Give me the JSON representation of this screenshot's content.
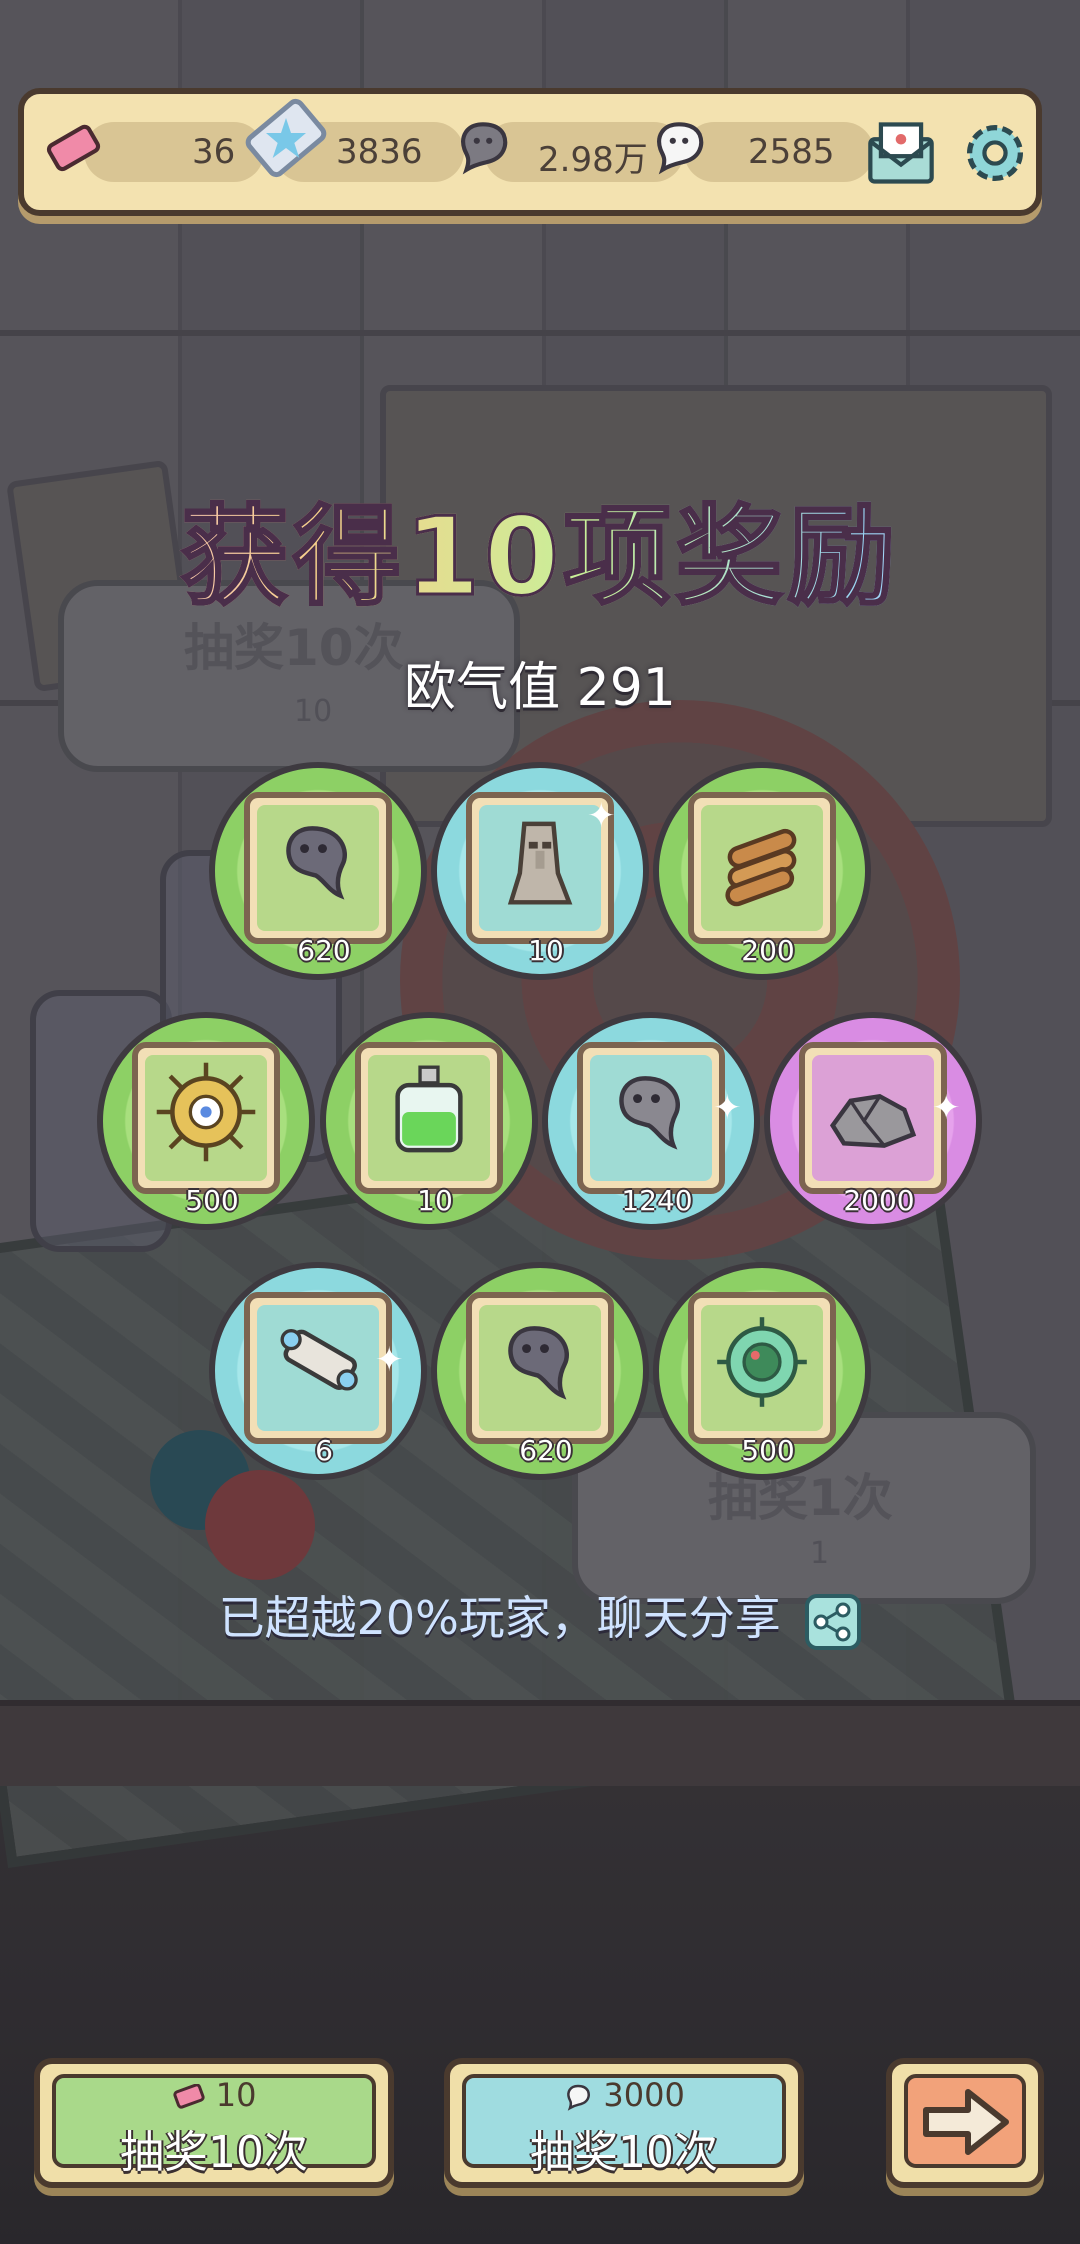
{
  "resources": [
    {
      "icon": "ticket-pink-icon",
      "value": "36"
    },
    {
      "icon": "ticket-blue-icon",
      "value": "3836"
    },
    {
      "icon": "ghost-gray-icon",
      "value": "2.98万"
    },
    {
      "icon": "ghost-white-icon",
      "value": "2585"
    }
  ],
  "header_buttons": {
    "mail": "mail-icon",
    "settings": "gear-icon"
  },
  "background_bubbles": {
    "left": {
      "title": "抽奖10次",
      "cost": "10"
    },
    "right": {
      "title": "抽奖1次",
      "cost": "1"
    }
  },
  "title": "获得10项奖励",
  "luck_text": "欧气值 291",
  "rewards": [
    {
      "icon": "ghost-essence-icon",
      "qty": "620",
      "rarity": "green"
    },
    {
      "icon": "stone-statue-icon",
      "qty": "10",
      "rarity": "blue"
    },
    {
      "icon": "wood-logs-icon",
      "qty": "200",
      "rarity": "green"
    },
    {
      "icon": "golden-wheel-icon",
      "qty": "500",
      "rarity": "green"
    },
    {
      "icon": "green-potion-icon",
      "qty": "10",
      "rarity": "green"
    },
    {
      "icon": "ghost-essence-icon",
      "qty": "1240",
      "rarity": "blue"
    },
    {
      "icon": "stone-ore-icon",
      "qty": "2000",
      "rarity": "purple"
    },
    {
      "icon": "scroll-icon",
      "qty": "6",
      "rarity": "blue"
    },
    {
      "icon": "ghost-essence-icon",
      "qty": "620",
      "rarity": "green"
    },
    {
      "icon": "green-orb-icon",
      "qty": "500",
      "rarity": "green"
    }
  ],
  "share_text": "已超越20%玩家，聊天分享",
  "buttons": {
    "draw_ticket": {
      "cost": "10",
      "label": "抽奖10次"
    },
    "draw_ghost": {
      "cost": "3000",
      "label": "抽奖10次"
    },
    "next": {
      "icon": "arrow-right-icon"
    }
  },
  "colors": {
    "green": "#8dd065",
    "blue": "#8cd9de",
    "purple": "#d98ce3",
    "button_green": "#a9d98a",
    "button_blue": "#9fdce0",
    "button_orange": "#f2a27a"
  }
}
